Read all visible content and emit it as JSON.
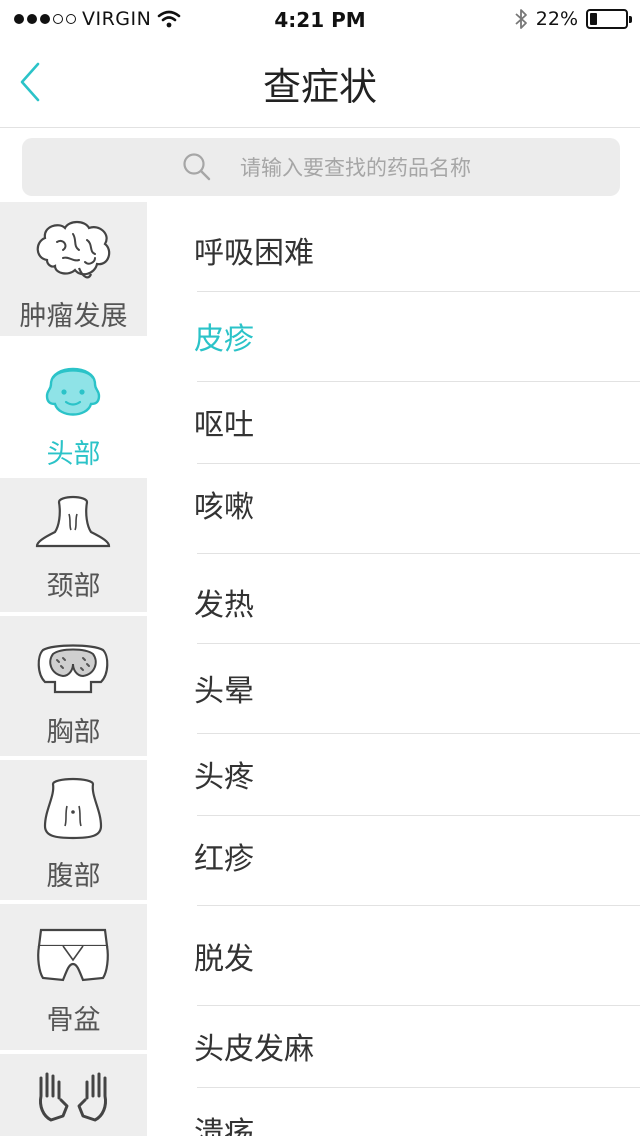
{
  "status_bar": {
    "carrier": "VIRGIN",
    "time": "4:21 PM",
    "battery_percent": "22%",
    "battery_level": 0.22,
    "signal_bars_filled": 3,
    "signal_bars_total": 5
  },
  "nav": {
    "title": "查症状",
    "back_icon": "chevron-left-icon"
  },
  "search": {
    "placeholder": "请输入要查找的药品名称",
    "icon": "search-icon"
  },
  "colors": {
    "accent": "#2bc3c8",
    "sidebar_bg": "#eeeeee",
    "search_bg": "#ececec"
  },
  "categories": [
    {
      "label": "肿瘤发展",
      "icon": "brain-icon",
      "active": false
    },
    {
      "label": "头部",
      "icon": "head-icon",
      "active": true
    },
    {
      "label": "颈部",
      "icon": "neck-icon",
      "active": false
    },
    {
      "label": "胸部",
      "icon": "chest-icon",
      "active": false
    },
    {
      "label": "腹部",
      "icon": "abdomen-icon",
      "active": false
    },
    {
      "label": "骨盆",
      "icon": "pelvis-icon",
      "active": false
    },
    {
      "label": "",
      "icon": "hands-icon",
      "active": false
    }
  ],
  "symptoms": [
    {
      "label": "呼吸困难",
      "selected": false
    },
    {
      "label": "皮疹",
      "selected": true
    },
    {
      "label": "呕吐",
      "selected": false
    },
    {
      "label": "咳嗽",
      "selected": false
    },
    {
      "label": "发热",
      "selected": false
    },
    {
      "label": "头晕",
      "selected": false
    },
    {
      "label": "头疼",
      "selected": false
    },
    {
      "label": "红疹",
      "selected": false
    },
    {
      "label": "脱发",
      "selected": false
    },
    {
      "label": "头皮发麻",
      "selected": false
    },
    {
      "label": "溃疡",
      "selected": false
    }
  ]
}
